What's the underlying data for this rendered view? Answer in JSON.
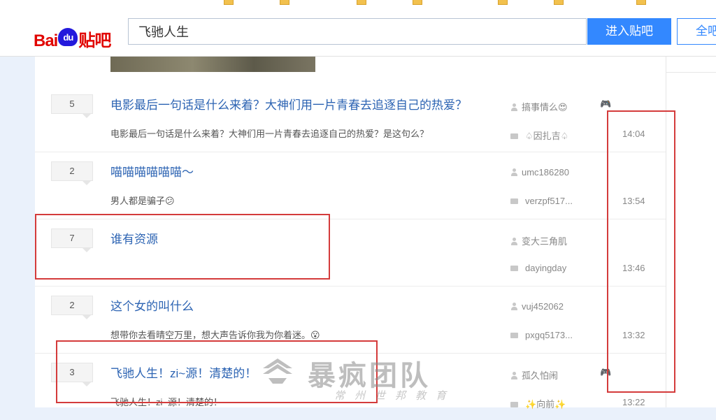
{
  "search": {
    "value": "飞驰人生",
    "enter_label": "进入贴吧",
    "all_label": "全吧"
  },
  "logo": {
    "bai": "Bai",
    "du": "du",
    "tieba": "贴吧"
  },
  "threads": [
    {
      "count": "5",
      "title": "电影最后一句话是什么来着？大神们用一片青春去追逐自己的热爱？",
      "excerpt": "电影最后一句话是什么来着？大神们用一片青春去追逐自己的热爱？是这句么？",
      "author": "搞事情么😍",
      "replier": "♤因扎吉♤",
      "time": "14:04",
      "badge": "🎮"
    },
    {
      "count": "2",
      "title": "喵喵喵喵喵喵～",
      "excerpt": "男人都是骗子😕",
      "author": "umc186280",
      "replier": "verzpf517...",
      "time": "13:54",
      "badge": ""
    },
    {
      "count": "7",
      "title": "谁有资源",
      "excerpt": "",
      "author": "变大三角肌",
      "replier": "dayingday",
      "time": "13:46",
      "badge": ""
    },
    {
      "count": "2",
      "title": "这个女的叫什么",
      "excerpt": "想带你去看晴空万里，想大声告诉你我为你着迷。😮",
      "author": "vuj452062",
      "replier": "pxgq5173...",
      "time": "13:32",
      "badge": ""
    },
    {
      "count": "3",
      "title": "飞驰人生！zi~源！清楚的！",
      "excerpt": "飞驰人生！zi~源！清楚的！",
      "author": "孤久怕闹",
      "replier": "✨向前✨",
      "time": "13:22",
      "badge": "🎮"
    }
  ],
  "watermark": {
    "main": "暴疯团队",
    "sub": "常州世邦教育"
  },
  "colors": {
    "accent": "#3388ff",
    "link": "#2d64b3",
    "annotation": "#d43b3b",
    "brand_red": "#e10602"
  }
}
